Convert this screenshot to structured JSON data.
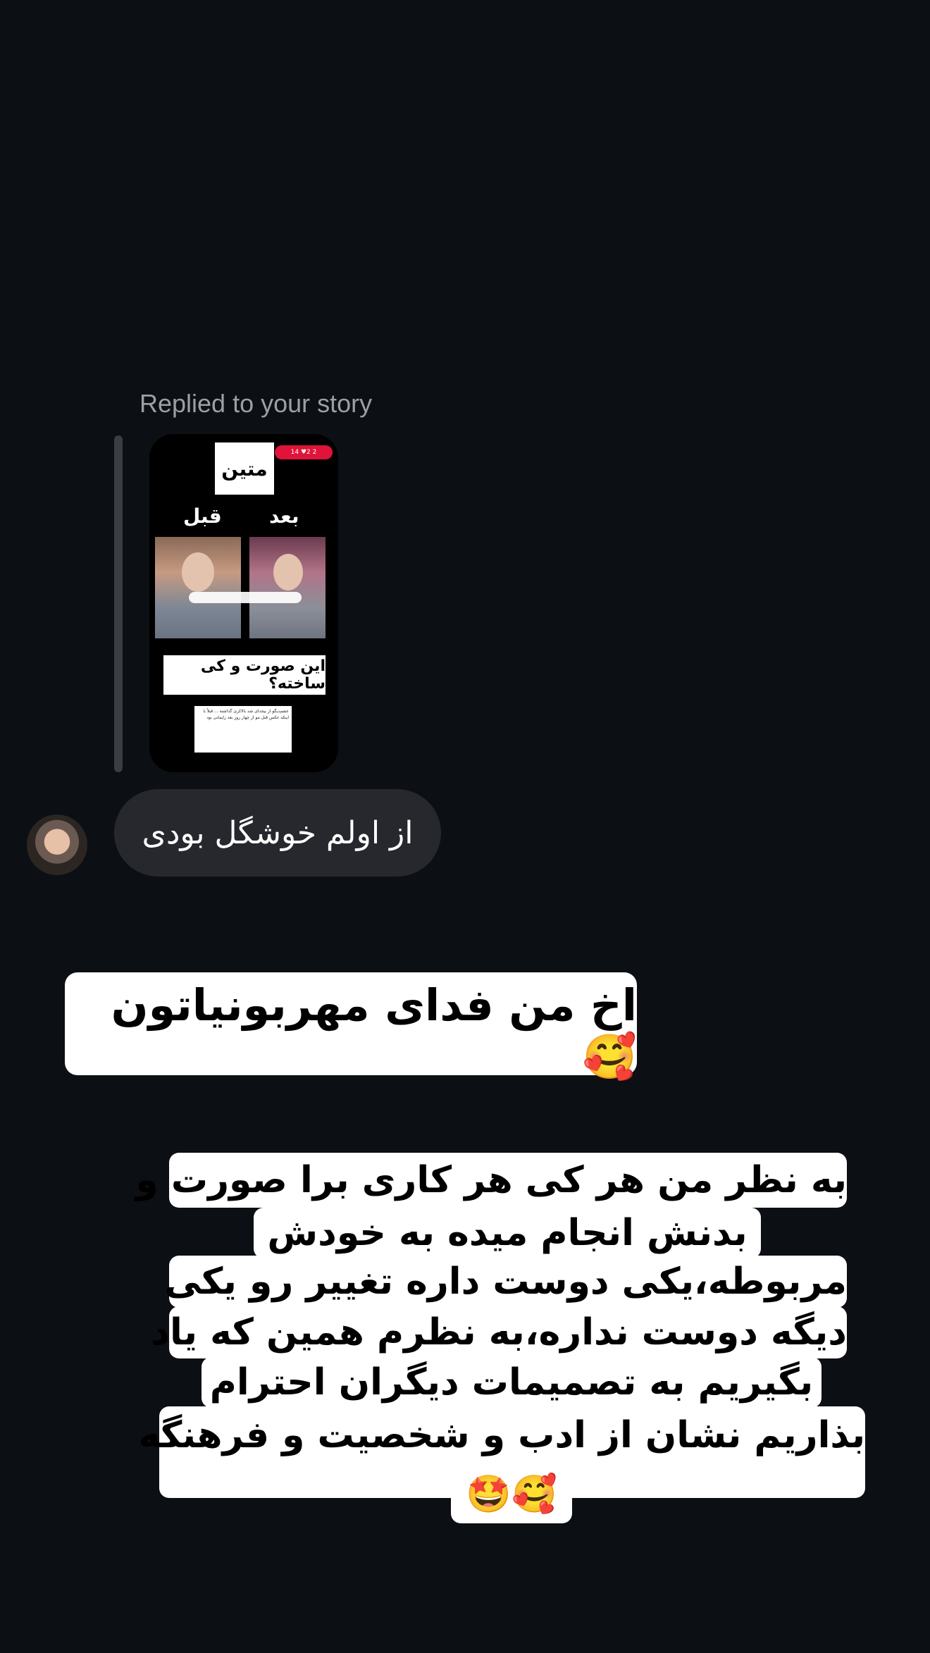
{
  "thread": {
    "replied_label": "Replied to your story",
    "story": {
      "title": "متین",
      "badge": "14 ♥2 2",
      "label_after": "بعد",
      "label_before": "قبل",
      "question": "این صورت و کی ساخته؟",
      "note": "عشم‌دیگو از بیجدای شد بالاکری گذاشته ... قبلاً با اینکه عکس قبل مو از چهار روز بعد زایمانی بود"
    },
    "incoming_message": "از اولم خوشگل بودی",
    "sticker_1": "اخ من فدای مهربونیاتون🥰",
    "sticker_2_lines": [
      "به نظر من هر کی هر کاری برا صورت و",
      "بدنش انجام میده به خودش",
      "مربوطه،یکی دوست داره تغییر رو یکی",
      "دیگه دوست نداره،به نظرم همین که یاد",
      "بگیریم به تصمیمات دیگران احترام",
      "بذاریم نشان از ادب و شخصیت و فرهنگه",
      "🥰🤩"
    ]
  },
  "colors": {
    "background": "#0c0f14",
    "bubble": "#26282d",
    "label": "#9aa0a6",
    "badge": "#e0133a"
  }
}
